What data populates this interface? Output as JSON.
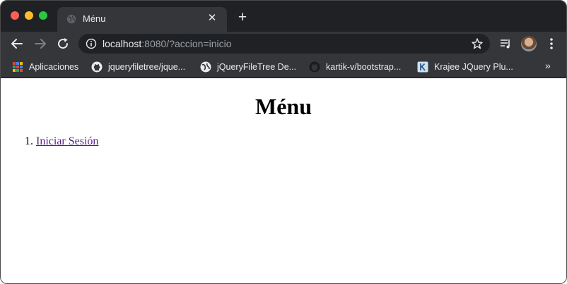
{
  "browser": {
    "tab": {
      "title": "Ménu",
      "close_label": "✕"
    },
    "new_tab_label": "+",
    "address": {
      "host": "localhost",
      "rest": ":8080/?accion=inicio"
    },
    "bookmarks": [
      {
        "label": "Aplicaciones",
        "icon": "apps-grid-icon"
      },
      {
        "label": "jqueryfiletree/jque...",
        "icon": "github-icon"
      },
      {
        "label": "jQueryFileTree De...",
        "icon": "globe-icon"
      },
      {
        "label": "kartik-v/bootstrap...",
        "icon": "github-icon"
      },
      {
        "label": "Krajee JQuery Plu...",
        "icon": "krajee-k-icon"
      }
    ],
    "bookmarks_overflow": "»",
    "colors": {
      "frame": "#202124",
      "toolbar": "#35363a",
      "link_visited": "#551a8b"
    }
  },
  "page": {
    "title": "Ménu",
    "menu": [
      {
        "number": "1.",
        "label": "Iniciar Sesión"
      }
    ]
  }
}
